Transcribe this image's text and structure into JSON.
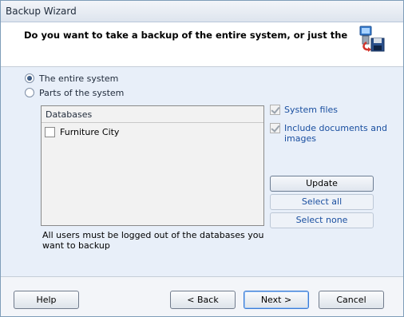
{
  "window": {
    "title": "Backup Wizard"
  },
  "header": {
    "question": "Do you want to take a backup of the entire system, or just the",
    "icon": "backup-computer-disk-icon"
  },
  "scope": {
    "options": [
      {
        "label": "The entire system",
        "checked": true
      },
      {
        "label": "Parts of the system",
        "checked": false
      }
    ]
  },
  "databases": {
    "header": "Databases",
    "items": [
      {
        "label": "Furniture City",
        "checked": false
      }
    ]
  },
  "include": {
    "system_files": "System files",
    "documents": "Include documents and images"
  },
  "actions": {
    "update": "Update",
    "select_all": "Select all",
    "select_none": "Select none"
  },
  "note": "All users must be logged out of the databases you want to backup",
  "footer": {
    "help": "Help",
    "back": "< Back",
    "next": "Next >",
    "cancel": "Cancel"
  },
  "colors": {
    "accent_blue": "#1a4fa0",
    "panel_bg": "#e8eff9"
  }
}
